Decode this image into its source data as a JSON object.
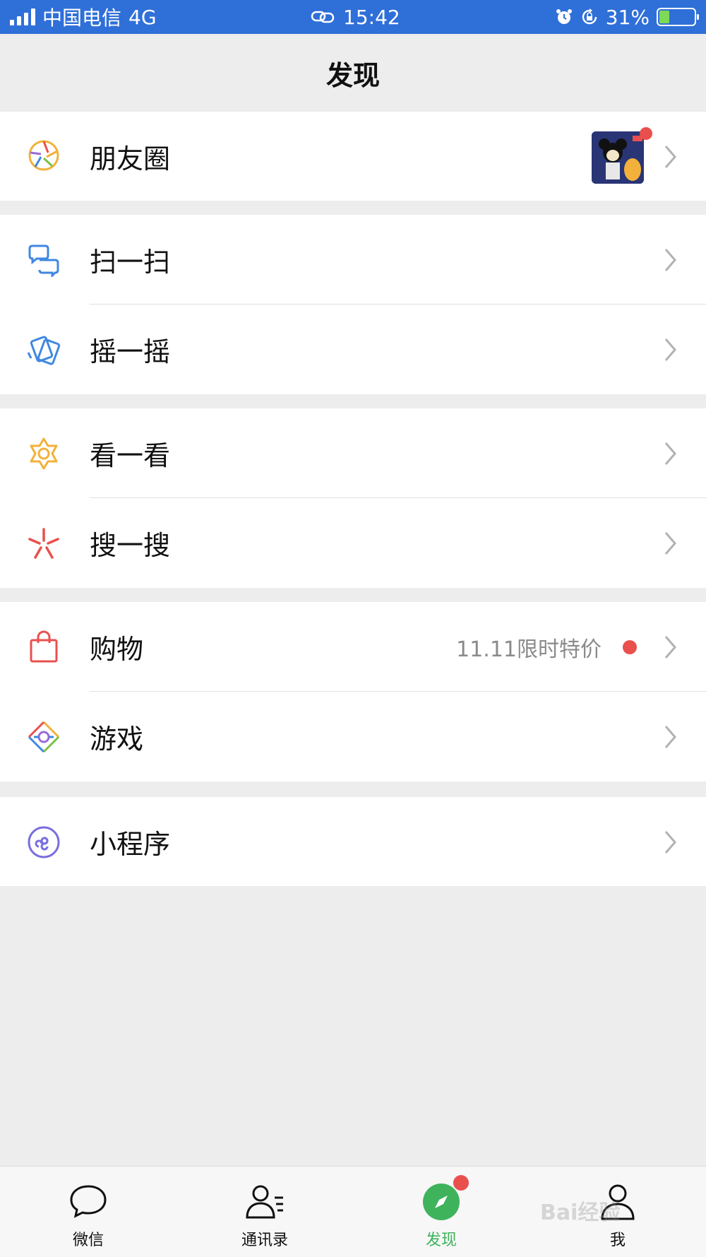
{
  "status_bar": {
    "carrier": "中国电信",
    "network": "4G",
    "time": "15:42",
    "battery": "31%"
  },
  "nav": {
    "title": "发现"
  },
  "groups": [
    [
      {
        "label": "朋友圈",
        "icon": "moments-aperture-icon"
      }
    ],
    [
      {
        "label": "扫一扫",
        "icon": "scan-icon"
      },
      {
        "label": "摇一摇",
        "icon": "shake-icon"
      }
    ],
    [
      {
        "label": "看一看",
        "icon": "top-stories-icon"
      },
      {
        "label": "搜一搜",
        "icon": "search-spark-icon"
      }
    ],
    [
      {
        "label": "购物",
        "icon": "shopping-bag-icon",
        "extra": "11.11限时特价"
      },
      {
        "label": "游戏",
        "icon": "games-icon"
      }
    ],
    [
      {
        "label": "小程序",
        "icon": "mini-programs-icon"
      }
    ]
  ],
  "tabs": [
    {
      "label": "微信",
      "icon": "chat-bubble-icon",
      "active": false
    },
    {
      "label": "通讯录",
      "icon": "contacts-icon",
      "active": false
    },
    {
      "label": "发现",
      "icon": "compass-icon",
      "active": true
    },
    {
      "label": "我",
      "icon": "person-icon",
      "active": false
    }
  ],
  "watermark": "Bai经验",
  "colors": {
    "status_bar_bg": "#2f6fd8",
    "background": "#ededed",
    "active_tab": "#3fb35b",
    "badge": "#e9504d"
  }
}
